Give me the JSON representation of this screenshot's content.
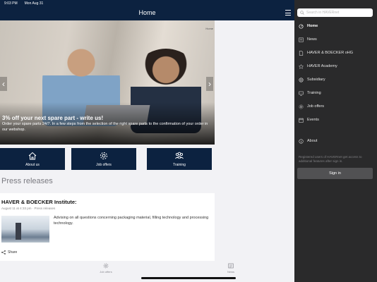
{
  "status_bar": {
    "time": "9:03 PM",
    "date": "Mon Aug 31"
  },
  "header": {
    "title": "Home"
  },
  "hero": {
    "pager": "Home",
    "headline": "3% off your next spare part - write us!",
    "text": "Order your spare parts 24/7. In a few steps from the selection of the right spare parts to the confirmation of your order in our webshop."
  },
  "quick_tiles": [
    {
      "label": "About us",
      "icon": "house-icon"
    },
    {
      "label": "Job offers",
      "icon": "gear-icon"
    },
    {
      "label": "Training",
      "icon": "people-icon"
    }
  ],
  "press": {
    "heading": "Press releases",
    "card": {
      "title": "HAVER & BOECKER Institute:",
      "meta": "August 11 at 4:33 pm · Press releases",
      "description": "Advising on all questions concerning packaging material, filling technology and processing technology.",
      "share_label": "Share"
    }
  },
  "bottom_nav": [
    {
      "label": "Job offers",
      "icon": "gear-icon"
    },
    {
      "label": "News",
      "icon": "news-icon"
    }
  ],
  "drawer": {
    "search_placeholder": "Search in HAVERnet",
    "items": [
      {
        "label": "Home",
        "icon": "home-icon",
        "active": true
      },
      {
        "label": "News",
        "icon": "news-icon",
        "active": false
      },
      {
        "label": "HAVER & BOECKER oHG",
        "icon": "document-icon",
        "active": false
      },
      {
        "label": "HAVER Academy",
        "icon": "star-icon",
        "active": false
      },
      {
        "label": "Subsidiary",
        "icon": "globe-icon",
        "active": false
      },
      {
        "label": "Training",
        "icon": "training-icon",
        "active": false
      },
      {
        "label": "Job offers",
        "icon": "gear-icon",
        "active": false
      },
      {
        "label": "Events",
        "icon": "events-icon",
        "active": false
      },
      {
        "label": "About",
        "icon": "info-icon",
        "active": false
      }
    ],
    "hint": "Registered users of HAVERnet get access to additional features after sign in.",
    "sign_in_label": "Sign in"
  },
  "colors": {
    "brand_navy": "#0c2240",
    "drawer_bg": "#2a2a2b",
    "signin_bg": "#515153"
  }
}
